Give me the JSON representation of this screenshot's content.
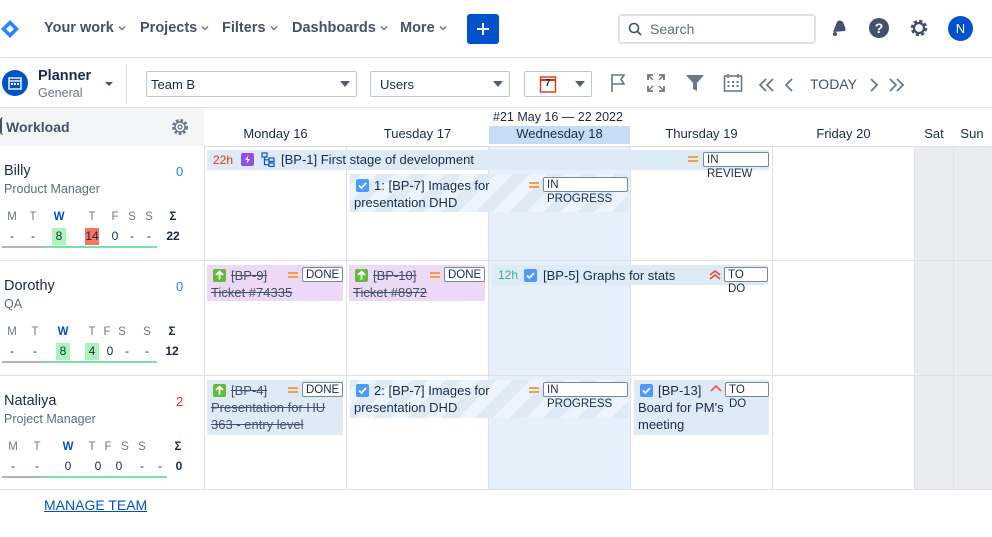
{
  "nav": {
    "items": [
      "Your work",
      "Projects",
      "Filters",
      "Dashboards",
      "More"
    ],
    "search_placeholder": "Search",
    "avatar_initial": "N",
    "colors": {
      "primary": "#0052cc"
    }
  },
  "toolbar": {
    "title": "Planner",
    "subtitle": "General",
    "team": "Team B",
    "group_by": "Users",
    "calendar_day": "7",
    "today_label": "TODAY"
  },
  "calendar": {
    "week_label": "#21 May 16 — 22 2022",
    "days": [
      "Monday 16",
      "Tuesday 17",
      "Wednesday 18",
      "Thursday 19",
      "Friday 20",
      "Sat",
      "Sun"
    ],
    "today_index": 2
  },
  "sidebar": {
    "workload_label": "Workload",
    "day_letters": [
      "M",
      "T",
      "W",
      "T",
      "F",
      "S",
      "S",
      "Σ"
    ],
    "people": [
      {
        "name": "Billy",
        "role": "Product Manager",
        "count": "0",
        "values": [
          "-",
          "-",
          "8",
          "14",
          "0",
          "-",
          "-",
          "22"
        ]
      },
      {
        "name": "Dorothy",
        "role": "QA",
        "count": "0",
        "values": [
          "-",
          "-",
          "8",
          "4",
          "0",
          "-",
          "-",
          "12"
        ]
      },
      {
        "name": "Nataliya",
        "role": "Project Manager",
        "count": "2",
        "values": [
          "-",
          "-",
          "0",
          "0",
          "0",
          "-",
          "-",
          "0"
        ]
      }
    ]
  },
  "tasks": {
    "billy_epic": {
      "hours": "22h",
      "text": "[BP-1] First stage of development",
      "status": "IN REVIEW"
    },
    "billy_1": {
      "line1": "1: [BP-7] Images for",
      "line2": "presentation DHD",
      "status": "IN PROGRESS"
    },
    "dorothy_mon": {
      "line1": "[BP-9]",
      "line2": "Ticket #74335",
      "status": "DONE"
    },
    "dorothy_tue": {
      "line1": "[BP-10]",
      "line2": "Ticket #8972",
      "status": "DONE"
    },
    "dorothy_wed": {
      "hours": "12h",
      "text": "[BP-5] Graphs for stats",
      "status": "TO DO"
    },
    "nataliya_mon": {
      "line1": "[BP-4]",
      "line2": "Presentation for HU",
      "line3": "363 - entry level",
      "status": "DONE"
    },
    "nataliya_tue": {
      "line1": "2: [BP-7] Images for",
      "line2": "presentation DHD",
      "status": "IN PROGRESS"
    },
    "nataliya_thu": {
      "line1": "[BP-13]",
      "line2": "Board for PM's",
      "line3": "meeting",
      "status": "TO DO"
    }
  },
  "footer": {
    "manage_team": "MANAGE TEAM"
  }
}
